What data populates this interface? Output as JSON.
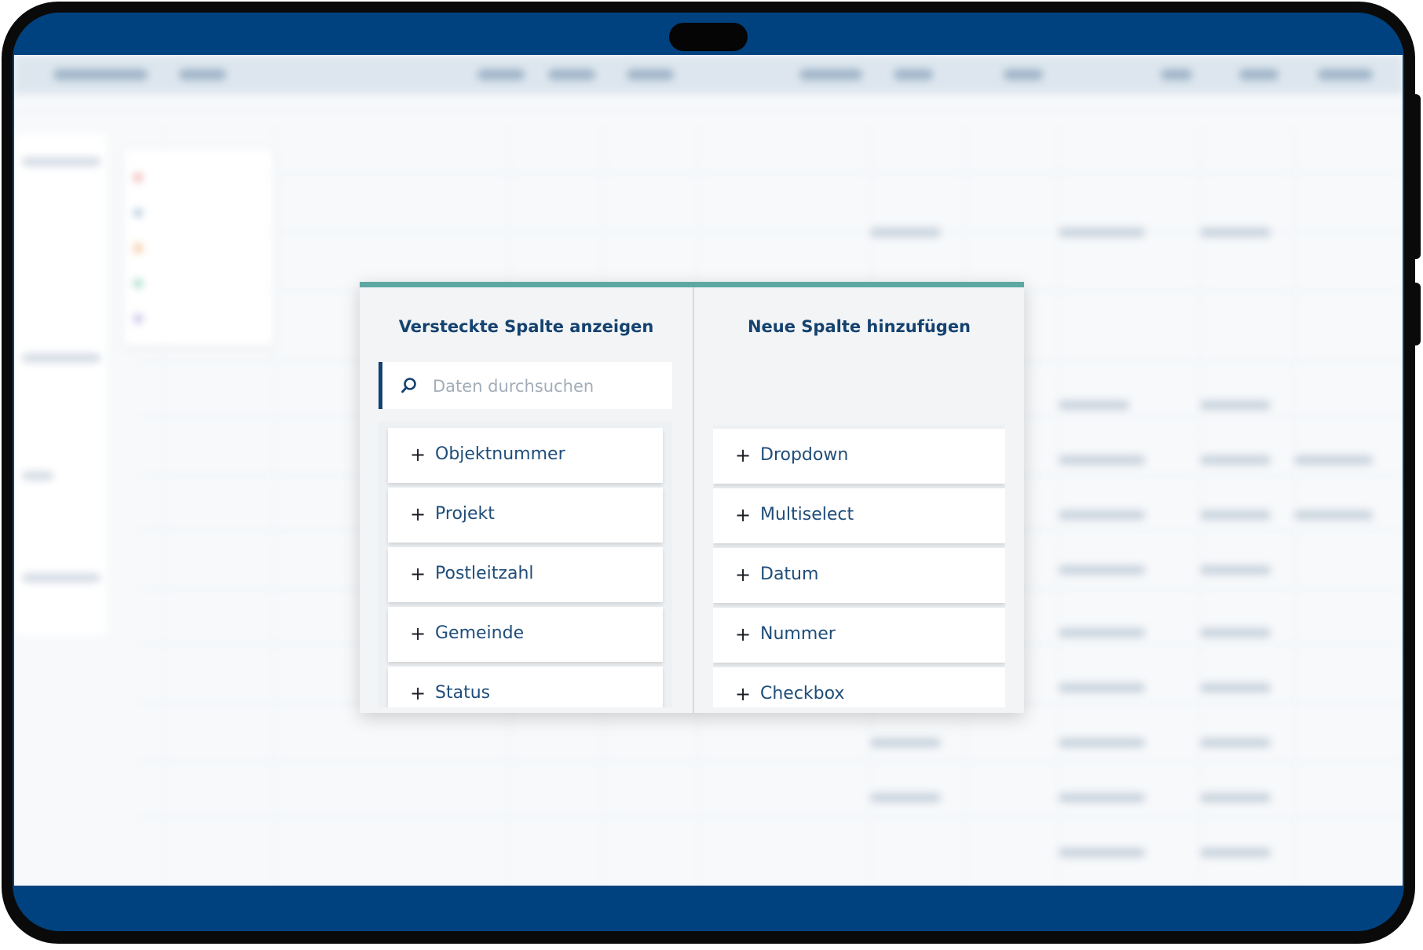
{
  "hidden_columns_panel": {
    "title": "Versteckte Spalte anzeigen",
    "search": {
      "placeholder": "Daten durchsuchen",
      "value": ""
    },
    "items": [
      {
        "label": "Objektnummer"
      },
      {
        "label": "Projekt"
      },
      {
        "label": "Postleitzahl"
      },
      {
        "label": "Gemeinde"
      },
      {
        "label": "Status"
      }
    ]
  },
  "add_column_panel": {
    "title": "Neue Spalte hinzufügen",
    "items": [
      {
        "label": "Dropdown"
      },
      {
        "label": "Multiselect"
      },
      {
        "label": "Datum"
      },
      {
        "label": "Nummer"
      },
      {
        "label": "Checkbox"
      }
    ]
  },
  "icons": {
    "search": "search-icon",
    "add": "plus-icon"
  },
  "colors": {
    "frame": "#00427f",
    "modal_top_border": "#5ea8a3",
    "title_text": "#15426e",
    "item_text": "#1f4d7a"
  }
}
